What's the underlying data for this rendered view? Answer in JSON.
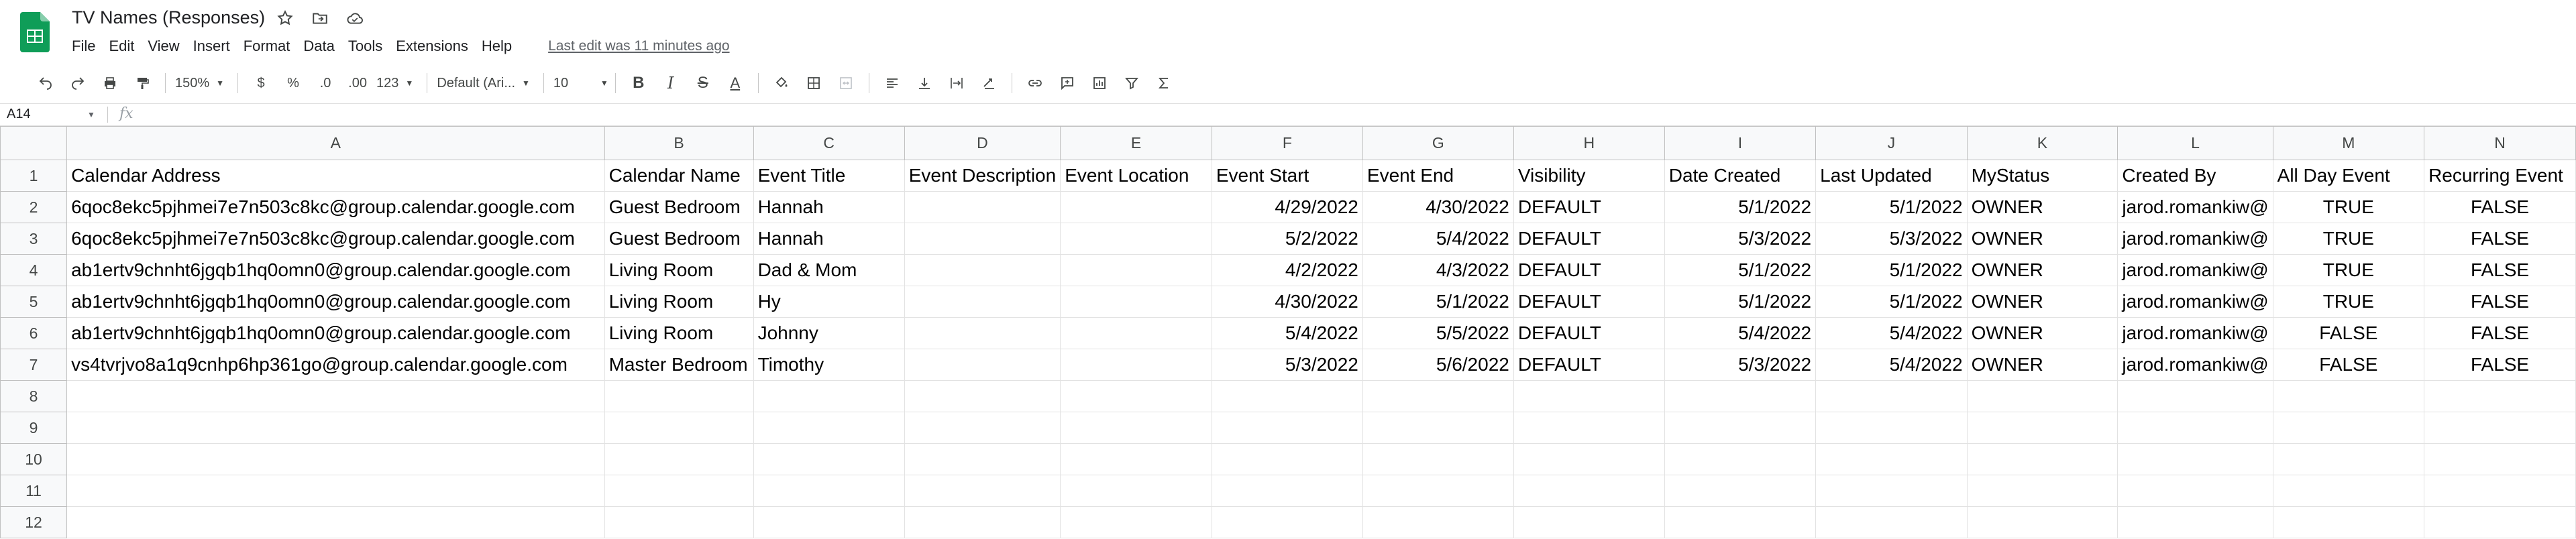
{
  "app": {
    "title": "TV Names (Responses)",
    "menus": [
      "File",
      "Edit",
      "View",
      "Insert",
      "Format",
      "Data",
      "Tools",
      "Extensions",
      "Help"
    ],
    "last_edit": "Last edit was 11 minutes ago",
    "brand_color": "#0F9D58"
  },
  "toolbar": {
    "zoom": "150%",
    "currency": "$",
    "percent": "%",
    "dec_decrease": ".0",
    "dec_increase": ".00",
    "more_formats": "123",
    "font": "Default (Ari...",
    "font_size": "10",
    "bold": "B",
    "italic": "I",
    "strike": "S",
    "text_color": "A"
  },
  "formula": {
    "cell_ref": "A14",
    "fx": "fx",
    "value": ""
  },
  "grid": {
    "columns": [
      "A",
      "B",
      "C",
      "D",
      "E",
      "F",
      "G",
      "H",
      "I",
      "J",
      "K",
      "L",
      "M",
      "N"
    ],
    "rows": [
      {
        "n": "1",
        "cells": [
          "Calendar Address",
          "Calendar Name",
          "Event Title",
          "Event Description",
          "Event Location",
          "Event Start",
          "Event End",
          "Visibility",
          "Date Created",
          "Last Updated",
          "MyStatus",
          "Created By",
          "All Day Event",
          "Recurring Event"
        ]
      },
      {
        "n": "2",
        "cells": [
          "6qoc8ekc5pjhmei7e7n503c8kc@group.calendar.google.com",
          "Guest Bedroom",
          "Hannah",
          "",
          "",
          "4/29/2022",
          "4/30/2022",
          "DEFAULT",
          "5/1/2022",
          "5/1/2022",
          "OWNER",
          "jarod.romankiw@",
          "TRUE",
          "FALSE"
        ]
      },
      {
        "n": "3",
        "cells": [
          "6qoc8ekc5pjhmei7e7n503c8kc@group.calendar.google.com",
          "Guest Bedroom",
          "Hannah",
          "",
          "",
          "5/2/2022",
          "5/4/2022",
          "DEFAULT",
          "5/3/2022",
          "5/3/2022",
          "OWNER",
          "jarod.romankiw@",
          "TRUE",
          "FALSE"
        ]
      },
      {
        "n": "4",
        "cells": [
          "ab1ertv9chnht6jgqb1hq0omn0@group.calendar.google.com",
          "Living Room",
          "Dad & Mom",
          "",
          "",
          "4/2/2022",
          "4/3/2022",
          "DEFAULT",
          "5/1/2022",
          "5/1/2022",
          "OWNER",
          "jarod.romankiw@",
          "TRUE",
          "FALSE"
        ]
      },
      {
        "n": "5",
        "cells": [
          "ab1ertv9chnht6jgqb1hq0omn0@group.calendar.google.com",
          "Living Room",
          "Hy",
          "",
          "",
          "4/30/2022",
          "5/1/2022",
          "DEFAULT",
          "5/1/2022",
          "5/1/2022",
          "OWNER",
          "jarod.romankiw@",
          "TRUE",
          "FALSE"
        ]
      },
      {
        "n": "6",
        "cells": [
          "ab1ertv9chnht6jgqb1hq0omn0@group.calendar.google.com",
          "Living Room",
          "Johnny",
          "",
          "",
          "5/4/2022",
          "5/5/2022",
          "DEFAULT",
          "5/4/2022",
          "5/4/2022",
          "OWNER",
          "jarod.romankiw@",
          "FALSE",
          "FALSE"
        ]
      },
      {
        "n": "7",
        "cells": [
          "vs4tvrjvo8a1q9cnhp6hp361go@group.calendar.google.com",
          "Master Bedroom",
          "Timothy",
          "",
          "",
          "5/3/2022",
          "5/6/2022",
          "DEFAULT",
          "5/3/2022",
          "5/4/2022",
          "OWNER",
          "jarod.romankiw@",
          "FALSE",
          "FALSE"
        ]
      },
      {
        "n": "8",
        "cells": [
          "",
          "",
          "",
          "",
          "",
          "",
          "",
          "",
          "",
          "",
          "",
          "",
          "",
          ""
        ]
      },
      {
        "n": "9",
        "cells": [
          "",
          "",
          "",
          "",
          "",
          "",
          "",
          "",
          "",
          "",
          "",
          "",
          "",
          ""
        ]
      },
      {
        "n": "10",
        "cells": [
          "",
          "",
          "",
          "",
          "",
          "",
          "",
          "",
          "",
          "",
          "",
          "",
          "",
          ""
        ]
      },
      {
        "n": "11",
        "cells": [
          "",
          "",
          "",
          "",
          "",
          "",
          "",
          "",
          "",
          "",
          "",
          "",
          "",
          ""
        ]
      },
      {
        "n": "12",
        "cells": [
          "",
          "",
          "",
          "",
          "",
          "",
          "",
          "",
          "",
          "",
          "",
          "",
          "",
          ""
        ]
      }
    ]
  }
}
